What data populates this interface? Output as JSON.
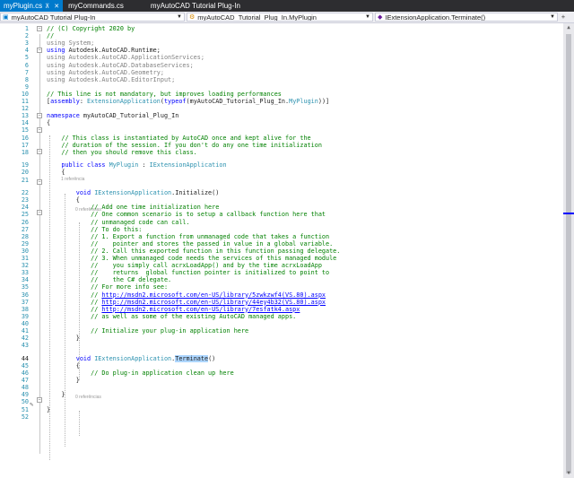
{
  "tabs": [
    {
      "label": "myPlugin.cs",
      "active": true,
      "pin": "⊼",
      "close": "✕"
    },
    {
      "label": "myCommands.cs",
      "active": false
    },
    {
      "label": "myAutoCAD Tutorial Plug-In",
      "active": false
    }
  ],
  "nav": {
    "project": "myAutoCAD Tutorial Plug-In",
    "type": "myAutoCAD_Tutorial_Plug_In.MyPlugin",
    "member": "IExtensionApplication.Terminate()"
  },
  "codelens": {
    "one_ref": "1 referência",
    "zero_ref": "0 referências"
  },
  "lines": [
    {
      "n": 1,
      "tokens": [
        [
          "cm",
          "// (C) Copyright 2020 by"
        ]
      ]
    },
    {
      "n": 2,
      "tokens": [
        [
          "cm",
          "//"
        ]
      ]
    },
    {
      "n": 3,
      "tokens": [
        [
          "gr",
          "using"
        ],
        [
          "",
          " "
        ],
        [
          "gr",
          "System;"
        ]
      ]
    },
    {
      "n": 4,
      "tokens": [
        [
          "kw",
          "using"
        ],
        [
          "",
          " Autodesk.AutoCAD.Runtime;"
        ]
      ]
    },
    {
      "n": 5,
      "tokens": [
        [
          "gr",
          "using Autodesk.AutoCAD.ApplicationServices;"
        ]
      ]
    },
    {
      "n": 6,
      "tokens": [
        [
          "gr",
          "using Autodesk.AutoCAD.DatabaseServices;"
        ]
      ]
    },
    {
      "n": 7,
      "tokens": [
        [
          "gr",
          "using Autodesk.AutoCAD.Geometry;"
        ]
      ]
    },
    {
      "n": 8,
      "tokens": [
        [
          "gr",
          "using Autodesk.AutoCAD.EditorInput;"
        ]
      ]
    },
    {
      "n": 9,
      "tokens": []
    },
    {
      "n": 10,
      "tokens": [
        [
          "cm",
          "// This line is not mandatory, but improves loading performances"
        ]
      ]
    },
    {
      "n": 11,
      "tokens": [
        [
          "",
          "["
        ],
        [
          "kw",
          "assembly"
        ],
        [
          "",
          ": "
        ],
        [
          "ty",
          "ExtensionApplication"
        ],
        [
          "",
          "("
        ],
        [
          "kw",
          "typeof"
        ],
        [
          "",
          "(myAutoCAD_Tutorial_Plug_In."
        ],
        [
          "ty",
          "MyPlugin"
        ],
        [
          "",
          "))]"
        ]
      ]
    },
    {
      "n": 12,
      "tokens": []
    },
    {
      "n": 13,
      "tokens": [
        [
          "kw",
          "namespace"
        ],
        [
          "",
          " myAutoCAD_Tutorial_Plug_In"
        ]
      ]
    },
    {
      "n": 14,
      "tokens": [
        [
          "",
          "{"
        ]
      ]
    },
    {
      "n": 15,
      "tokens": []
    },
    {
      "n": 16,
      "tokens": [
        [
          "cm",
          "    // This class is instantiated by AutoCAD once and kept alive for the"
        ]
      ]
    },
    {
      "n": 17,
      "tokens": [
        [
          "cm",
          "    // duration of the session. If you don't do any one time initialization"
        ]
      ]
    },
    {
      "n": 18,
      "tokens": [
        [
          "cm",
          "    // then you should remove this class."
        ]
      ]
    },
    {
      "n": 19,
      "tokens": [
        [
          "kw",
          "    public class"
        ],
        [
          "",
          " "
        ],
        [
          "ty",
          "MyPlugin"
        ],
        [
          "",
          " : "
        ],
        [
          "ty",
          "IExtensionApplication"
        ]
      ]
    },
    {
      "n": 20,
      "tokens": [
        [
          "",
          "    {"
        ]
      ]
    },
    {
      "n": 21,
      "tokens": []
    },
    {
      "n": 22,
      "tokens": [
        [
          "kw",
          "        void"
        ],
        [
          "",
          " "
        ],
        [
          "ty",
          "IExtensionApplication"
        ],
        [
          "",
          ".Initialize()"
        ]
      ]
    },
    {
      "n": 23,
      "tokens": [
        [
          "",
          "        {"
        ]
      ]
    },
    {
      "n": 24,
      "tokens": [
        [
          "cm",
          "            // Add one time initialization here"
        ]
      ]
    },
    {
      "n": 25,
      "tokens": [
        [
          "cm",
          "            // One common scenario is to setup a callback function here that"
        ]
      ]
    },
    {
      "n": 26,
      "tokens": [
        [
          "cm",
          "            // unmanaged code can call."
        ]
      ]
    },
    {
      "n": 27,
      "tokens": [
        [
          "cm",
          "            // To do this:"
        ]
      ]
    },
    {
      "n": 28,
      "tokens": [
        [
          "cm",
          "            // 1. Export a function from unmanaged code that takes a function"
        ]
      ]
    },
    {
      "n": 29,
      "tokens": [
        [
          "cm",
          "            //    pointer and stores the passed in value in a global variable."
        ]
      ]
    },
    {
      "n": 30,
      "tokens": [
        [
          "cm",
          "            // 2. Call this exported function in this function passing delegate."
        ]
      ]
    },
    {
      "n": 31,
      "tokens": [
        [
          "cm",
          "            // 3. When unmanaged code needs the services of this managed module"
        ]
      ]
    },
    {
      "n": 32,
      "tokens": [
        [
          "cm",
          "            //    you simply call acrxLoadApp() and by the time acrxLoadApp"
        ]
      ]
    },
    {
      "n": 33,
      "tokens": [
        [
          "cm",
          "            //    returns  global function pointer is initialized to point to"
        ]
      ]
    },
    {
      "n": 34,
      "tokens": [
        [
          "cm",
          "            //    the C# delegate."
        ]
      ]
    },
    {
      "n": 35,
      "tokens": [
        [
          "cm",
          "            // For more info see:"
        ]
      ]
    },
    {
      "n": 36,
      "tokens": [
        [
          "cm",
          "            // "
        ],
        [
          "lnk",
          "http://msdn2.microsoft.com/en-US/library/5zwkzwf4(VS.80).aspx"
        ]
      ]
    },
    {
      "n": 37,
      "tokens": [
        [
          "cm",
          "            // "
        ],
        [
          "lnk",
          "http://msdn2.microsoft.com/en-US/library/44ey4b32(VS.80).aspx"
        ]
      ]
    },
    {
      "n": 38,
      "tokens": [
        [
          "cm",
          "            // "
        ],
        [
          "lnk",
          "http://msdn2.microsoft.com/en-US/library/7esfatk4.aspx"
        ]
      ]
    },
    {
      "n": 39,
      "tokens": [
        [
          "cm",
          "            // as well as some of the existing AutoCAD managed apps."
        ]
      ]
    },
    {
      "n": 40,
      "tokens": []
    },
    {
      "n": 41,
      "tokens": [
        [
          "cm",
          "            // Initialize your plug-in application here"
        ]
      ]
    },
    {
      "n": 42,
      "tokens": [
        [
          "",
          "        }"
        ]
      ]
    },
    {
      "n": 43,
      "tokens": []
    },
    {
      "n": 44,
      "tokens": [
        [
          "kw",
          "        void"
        ],
        [
          "",
          " "
        ],
        [
          "ty",
          "IExtensionApplication"
        ],
        [
          "",
          "."
        ],
        [
          "hl",
          "Terminate"
        ],
        [
          "",
          "()"
        ]
      ]
    },
    {
      "n": 45,
      "tokens": [
        [
          "",
          "        {"
        ]
      ]
    },
    {
      "n": 46,
      "tokens": [
        [
          "cm",
          "            // Do plug-in application clean up here"
        ]
      ]
    },
    {
      "n": 47,
      "tokens": [
        [
          "",
          "        }"
        ]
      ]
    },
    {
      "n": 48,
      "tokens": []
    },
    {
      "n": 49,
      "tokens": [
        [
          "",
          "    }"
        ]
      ]
    },
    {
      "n": 50,
      "tokens": []
    },
    {
      "n": 51,
      "tokens": [
        [
          "",
          "}"
        ]
      ]
    },
    {
      "n": 52,
      "tokens": []
    }
  ],
  "colors": {
    "tab_active": "#007acc",
    "tabbar_bg": "#2d2d30",
    "comment": "#008000",
    "keyword": "#0000ff",
    "type": "#2b91af",
    "line_number": "#2b91af"
  }
}
